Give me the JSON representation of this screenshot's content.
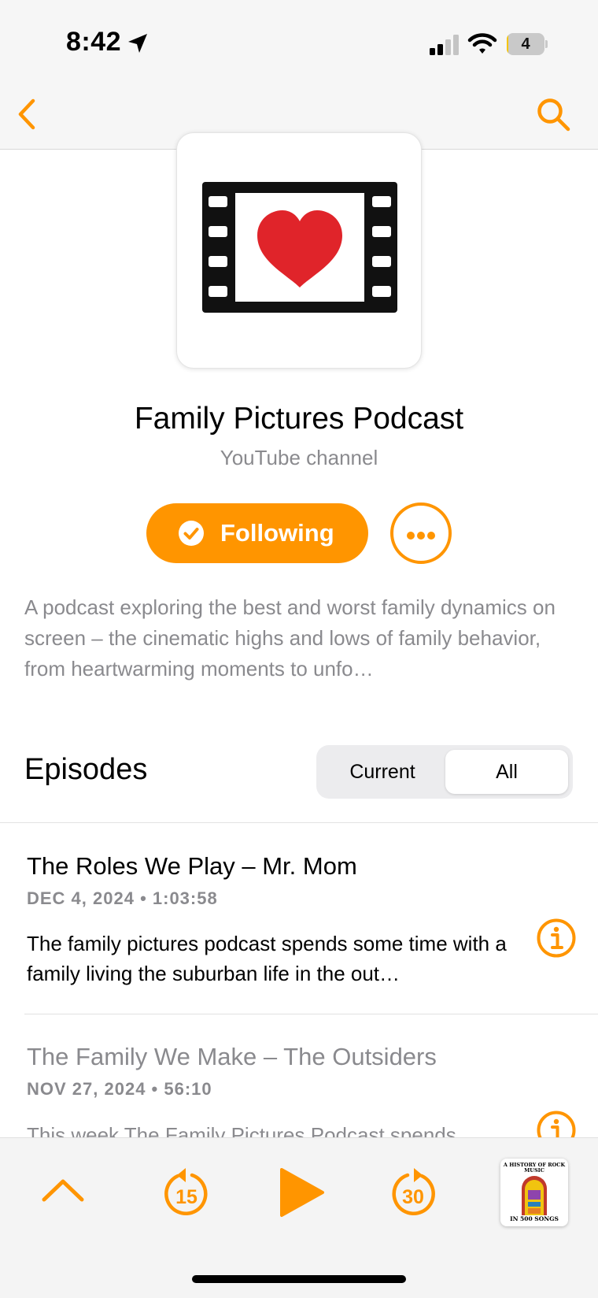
{
  "status_bar": {
    "time": "8:42",
    "battery_level": "4",
    "battery_fraction": 0.04,
    "icons": [
      "location-arrow-icon",
      "cellular-signal-icon",
      "wifi-icon",
      "battery-icon"
    ]
  },
  "nav": {
    "icons": [
      "chevron-left-icon",
      "search-icon"
    ]
  },
  "podcast": {
    "title": "Family Pictures Podcast",
    "author": "YouTube channel",
    "artwork_icon": "film-strip-heart-icon",
    "follow_label": "Following",
    "description": "A podcast exploring the best and worst family dynamics on screen – the cinematic highs and lows of family behavior, from heartwarming moments to unfo…"
  },
  "episodes_section": {
    "heading": "Episodes",
    "segments": [
      "Current",
      "All"
    ],
    "selected_segment": "All"
  },
  "episodes": [
    {
      "title": "The Roles We Play – Mr. Mom",
      "meta": "DEC 4, 2024 • 1:03:58",
      "description": "The family pictures podcast spends some time with a family living the suburban life in the out…"
    },
    {
      "title": "The Family We Make – The Outsiders",
      "meta": "NOV 27, 2024 • 56:10",
      "description": "This week The Family Pictures Podcast spends"
    }
  ],
  "mini_player": {
    "skip_back_seconds": "15",
    "skip_forward_seconds": "30",
    "now_playing_art_top": "A HISTORY OF ROCK MUSIC",
    "now_playing_art_bottom": "IN 500 SONGS"
  },
  "colors": {
    "accent": "#ff9500",
    "secondary_text": "#8a8a8e",
    "heart": "#e0242a"
  }
}
